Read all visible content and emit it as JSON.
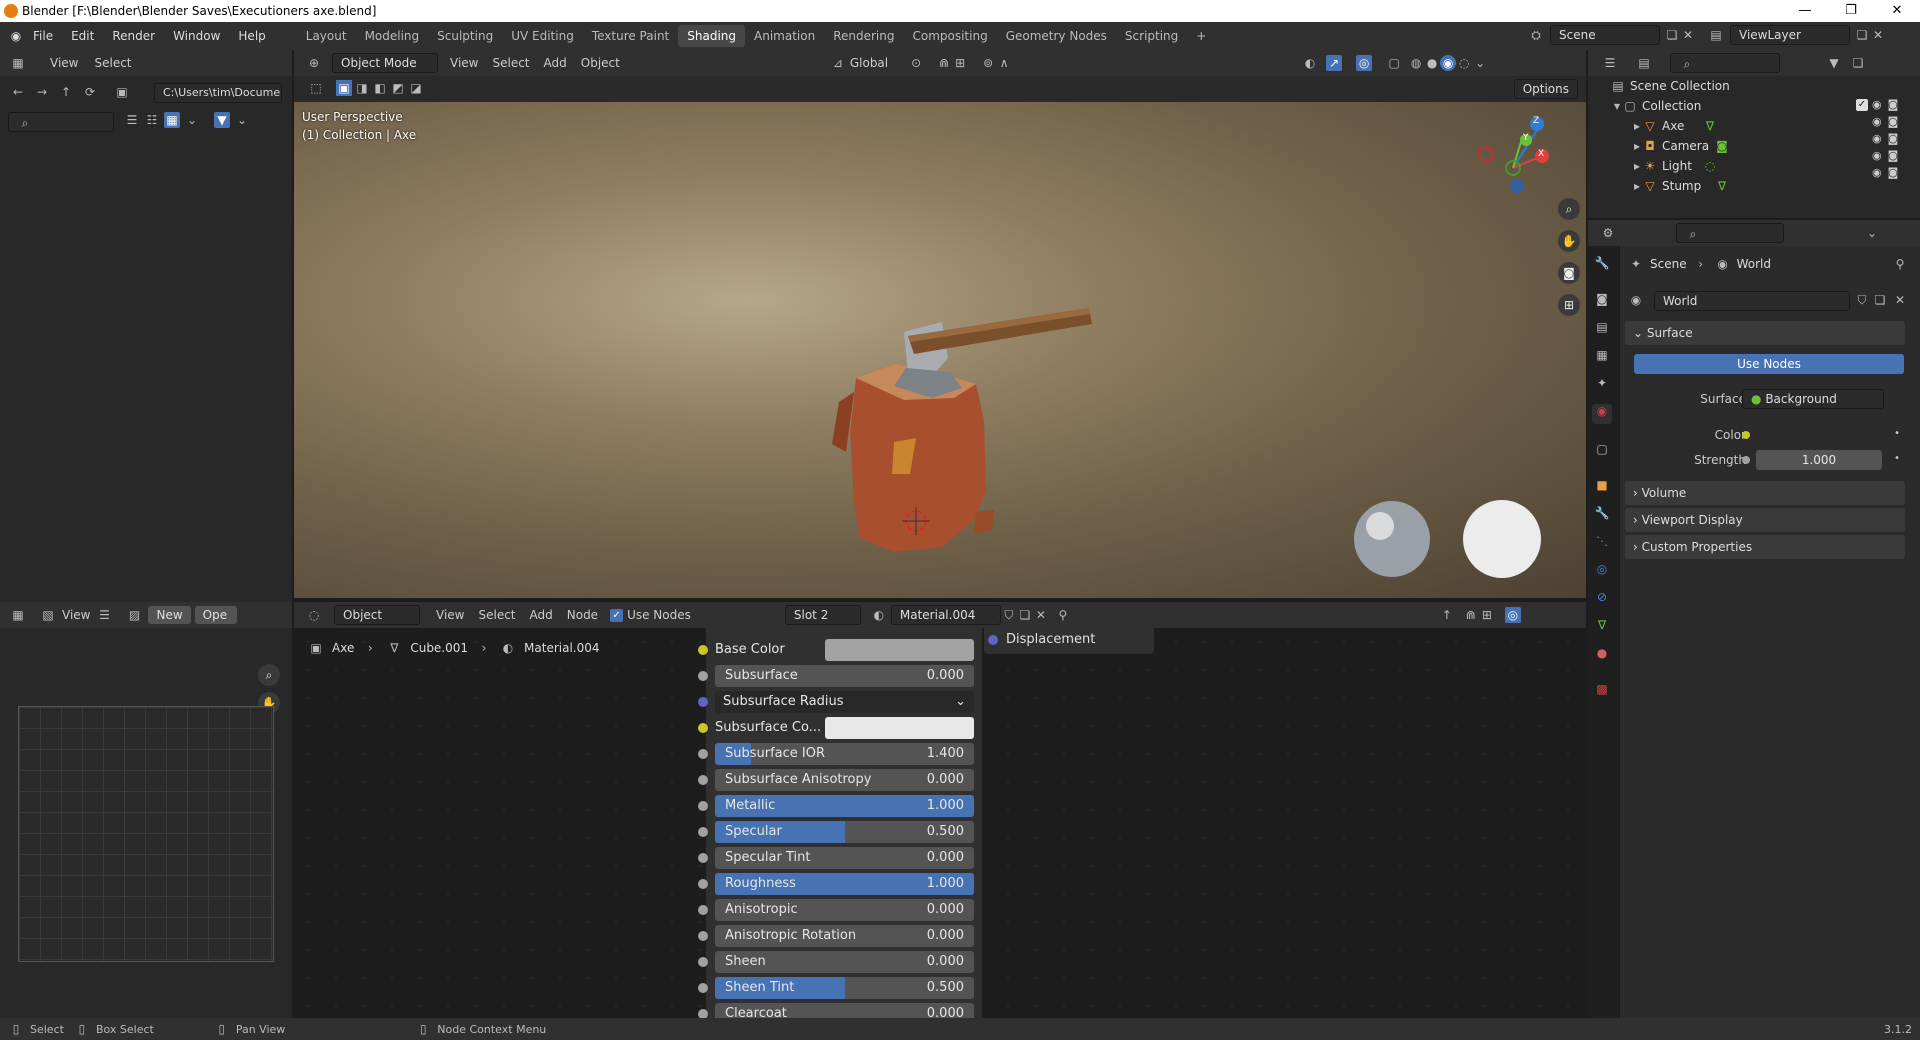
{
  "window": {
    "title": "Blender [F:\\Blender\\Blender Saves\\Executioners axe.blend]",
    "min": "—",
    "max": "❐",
    "close": "✕"
  },
  "menu": {
    "items": [
      "File",
      "Edit",
      "Render",
      "Window",
      "Help"
    ]
  },
  "workspaces": {
    "tabs": [
      "Layout",
      "Modeling",
      "Sculpting",
      "UV Editing",
      "Texture Paint",
      "Shading",
      "Animation",
      "Rendering",
      "Compositing",
      "Geometry Nodes",
      "Scripting"
    ],
    "active": "Shading",
    "add": "+"
  },
  "top_right": {
    "scene": "Scene",
    "view_layer": "ViewLayer"
  },
  "file_browser": {
    "view": "View",
    "select": "Select",
    "path": "C:\\Users\\tim\\Docume..."
  },
  "viewport": {
    "mode": "Object Mode",
    "view": "View",
    "select": "Select",
    "add": "Add",
    "object": "Object",
    "orientation": "Global",
    "options": "Options",
    "perspective": "User Perspective",
    "collection_info": "(1) Collection | Axe",
    "gizmo": {
      "x": "X",
      "y": "Y",
      "z": "Z"
    }
  },
  "image_editor": {
    "view": "View",
    "new": "New",
    "open": "Ope"
  },
  "node_editor": {
    "object": "Object",
    "view": "View",
    "select": "Select",
    "add": "Add",
    "node": "Node",
    "use_nodes": "Use Nodes",
    "slot": "Slot 2",
    "material": "Material.004",
    "breadcrumb": {
      "object": "Axe",
      "mesh": "Cube.001",
      "material": "Material.004"
    },
    "displacement": "Displacement"
  },
  "bsdf": [
    {
      "label": "Base Color",
      "type": "color",
      "socket": "#c7c729",
      "color": "#a3a3a3"
    },
    {
      "label": "Subsurface",
      "value": "0.000",
      "fill": 0,
      "socket": "#a1a1a1"
    },
    {
      "label": "Subsurface Radius",
      "type": "dropdown",
      "socket": "#6363c7"
    },
    {
      "label": "Subsurface Co...",
      "type": "color",
      "socket": "#c7c729",
      "color": "#e8e8e8"
    },
    {
      "label": "Subsurface IOR",
      "value": "1.400",
      "fill": 0.14,
      "socket": "#a1a1a1"
    },
    {
      "label": "Subsurface Anisotropy",
      "value": "0.000",
      "fill": 0,
      "socket": "#a1a1a1"
    },
    {
      "label": "Metallic",
      "value": "1.000",
      "fill": 1,
      "socket": "#a1a1a1"
    },
    {
      "label": "Specular",
      "value": "0.500",
      "fill": 0.5,
      "socket": "#a1a1a1"
    },
    {
      "label": "Specular Tint",
      "value": "0.000",
      "fill": 0,
      "socket": "#a1a1a1"
    },
    {
      "label": "Roughness",
      "value": "1.000",
      "fill": 1,
      "socket": "#a1a1a1"
    },
    {
      "label": "Anisotropic",
      "value": "0.000",
      "fill": 0,
      "socket": "#a1a1a1"
    },
    {
      "label": "Anisotropic Rotation",
      "value": "0.000",
      "fill": 0,
      "socket": "#a1a1a1"
    },
    {
      "label": "Sheen",
      "value": "0.000",
      "fill": 0,
      "socket": "#a1a1a1"
    },
    {
      "label": "Sheen Tint",
      "value": "0.500",
      "fill": 0.5,
      "socket": "#a1a1a1"
    },
    {
      "label": "Clearcoat",
      "value": "0.000",
      "fill": 0,
      "socket": "#a1a1a1"
    }
  ],
  "outliner": {
    "scene_collection": "Scene Collection",
    "collection": "Collection",
    "items": [
      {
        "name": "Axe",
        "icon": "mesh-icon"
      },
      {
        "name": "Camera",
        "icon": "camera-icon"
      },
      {
        "name": "Light",
        "icon": "light-icon"
      },
      {
        "name": "Stump",
        "icon": "mesh-icon"
      }
    ]
  },
  "properties": {
    "breadcrumb_scene": "Scene",
    "breadcrumb_world": "World",
    "world_name": "World",
    "surface_panel": "Surface",
    "use_nodes": "Use Nodes",
    "surface_label": "Surface",
    "surface_value": "Background",
    "color_label": "Color",
    "strength_label": "Strength",
    "strength_value": "1.000",
    "panels": [
      "Volume",
      "Viewport Display",
      "Custom Properties"
    ]
  },
  "statusbar": {
    "select": "Select",
    "box_select": "Box Select",
    "pan_view": "Pan View",
    "node_context": "Node Context Menu",
    "version": "3.1.2"
  },
  "colors": {
    "accent": "#4772b3",
    "header": "#303030",
    "field": "#545454"
  }
}
